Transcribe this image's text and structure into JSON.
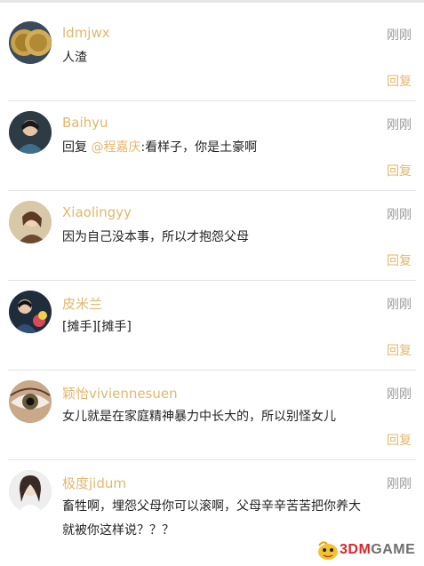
{
  "comments": [
    {
      "username": "ldmjwx",
      "time": "刚刚",
      "text": "人渣",
      "reply_label": "回复",
      "avatar": "coin-avatar-icon"
    },
    {
      "username": "Baihyu",
      "time": "刚刚",
      "text_prefix": "回复 ",
      "mention": "@程嘉庆",
      "text": ":看样子，你是土豪啊",
      "reply_label": "回复",
      "avatar": "person-avatar-icon"
    },
    {
      "username": "Xiaolingyy",
      "time": "刚刚",
      "text": "因为自己没本事，所以才抱怨父母",
      "reply_label": "回复",
      "avatar": "person-avatar-icon"
    },
    {
      "username": "皮米兰",
      "time": "刚刚",
      "text": "[摊手][摊手]",
      "reply_label": "回复",
      "avatar": "person-avatar-icon"
    },
    {
      "username": "颖怡viviennesuen",
      "time": "刚刚",
      "text": "女儿就是在家庭精神暴力中长大的，所以别怪女儿",
      "reply_label": "回复",
      "avatar": "eye-avatar-icon"
    },
    {
      "username": "极度jidum",
      "time": "刚刚",
      "text_line1": "畜牲啊，埋怨父母你可以滚啊，父母辛辛苦苦把你养大",
      "text_line2": "就被你这样说？？？",
      "avatar": "person-avatar-icon"
    }
  ],
  "watermark": {
    "brand_3dm": "3DM",
    "brand_game": "GAME",
    "accent": "#d9262a"
  },
  "colors": {
    "username": "#e2b76e",
    "time": "#999999",
    "text": "#222222"
  }
}
